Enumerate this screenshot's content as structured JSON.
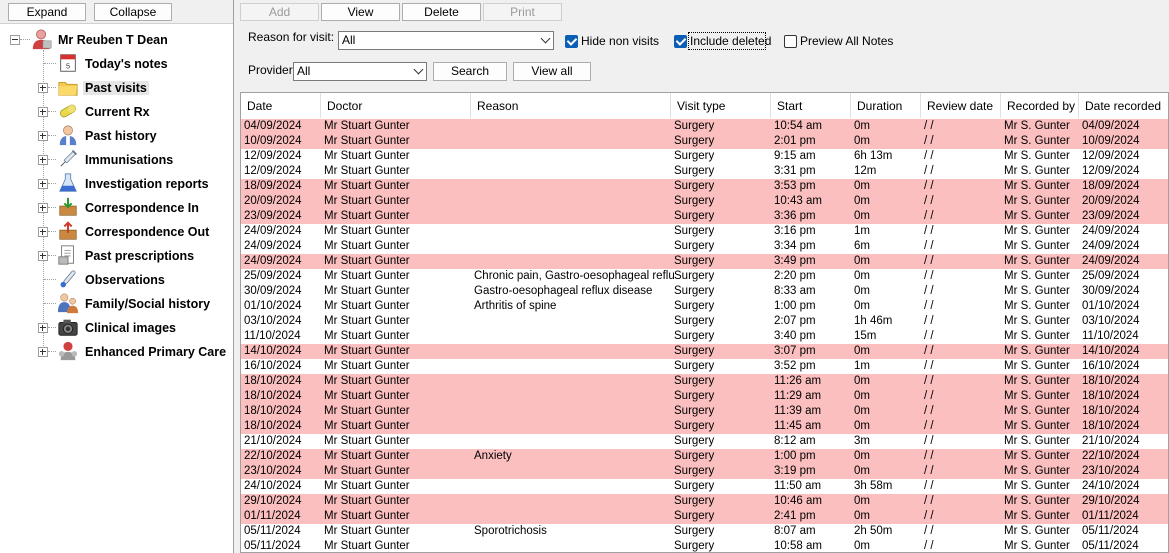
{
  "left_pane": {
    "expand_label": "Expand",
    "collapse_label": "Collapse",
    "root": {
      "label": "Mr Reuben T Dean",
      "icon": "person-icon"
    },
    "items": [
      {
        "label": "Today's notes",
        "icon": "calendar-icon",
        "expandable": false
      },
      {
        "label": "Past visits",
        "icon": "folder-icon",
        "expandable": true,
        "selected": true
      },
      {
        "label": "Current Rx",
        "icon": "pill-icon",
        "expandable": true
      },
      {
        "label": "Past history",
        "icon": "doctor-icon",
        "expandable": true
      },
      {
        "label": "Immunisations",
        "icon": "syringe-icon",
        "expandable": true
      },
      {
        "label": "Investigation reports",
        "icon": "flask-icon",
        "expandable": true
      },
      {
        "label": "Correspondence In",
        "icon": "inbox-icon",
        "expandable": true
      },
      {
        "label": "Correspondence Out",
        "icon": "outbox-icon",
        "expandable": true
      },
      {
        "label": "Past prescriptions",
        "icon": "prescription-icon",
        "expandable": true
      },
      {
        "label": "Observations",
        "icon": "thermometer-icon",
        "expandable": false
      },
      {
        "label": "Family/Social history",
        "icon": "family-icon",
        "expandable": false
      },
      {
        "label": "Clinical images",
        "icon": "camera-icon",
        "expandable": true
      },
      {
        "label": "Enhanced Primary Care",
        "icon": "team-icon",
        "expandable": true
      }
    ]
  },
  "toolbar": {
    "add_label": "Add",
    "view_label": "View",
    "delete_label": "Delete",
    "print_label": "Print"
  },
  "filters": {
    "reason_label": "Reason for visit:",
    "reason_value": "All",
    "hide_non_visits_label": "Hide non visits",
    "hide_non_visits_checked": true,
    "include_deleted_label": "Include deleted",
    "include_deleted_checked": true,
    "preview_all_notes_label": "Preview All Notes",
    "preview_all_notes_checked": false,
    "provider_label": "Provider:",
    "provider_value": "All",
    "search_label": "Search",
    "view_all_label": "View all"
  },
  "colors": {
    "highlight_row": "#fbbfbf",
    "checkbox_checked": "#0a5fb4"
  },
  "table": {
    "columns": [
      "Date",
      "Doctor",
      "Reason",
      "Visit type",
      "Start",
      "Duration",
      "Review date",
      "Recorded by",
      "Date recorded"
    ],
    "rows": [
      {
        "hl": true,
        "cells": [
          "04/09/2024",
          "Mr Stuart Gunter",
          "",
          "Surgery",
          "10:54 am",
          "0m",
          "/ /",
          "Mr S. Gunter",
          "04/09/2024"
        ]
      },
      {
        "hl": true,
        "cells": [
          "10/09/2024",
          "Mr Stuart Gunter",
          "",
          "Surgery",
          "2:01 pm",
          "0m",
          "/ /",
          "Mr S. Gunter",
          "10/09/2024"
        ]
      },
      {
        "hl": false,
        "cells": [
          "12/09/2024",
          "Mr Stuart Gunter",
          "",
          "Surgery",
          "9:15 am",
          "6h 13m",
          "/ /",
          "Mr S. Gunter",
          "12/09/2024"
        ]
      },
      {
        "hl": false,
        "cells": [
          "12/09/2024",
          "Mr Stuart Gunter",
          "",
          "Surgery",
          "3:31 pm",
          "12m",
          "/ /",
          "Mr S. Gunter",
          "12/09/2024"
        ]
      },
      {
        "hl": true,
        "cells": [
          "18/09/2024",
          "Mr Stuart Gunter",
          "",
          "Surgery",
          "3:53 pm",
          "0m",
          "/ /",
          "Mr S. Gunter",
          "18/09/2024"
        ]
      },
      {
        "hl": true,
        "cells": [
          "20/09/2024",
          "Mr Stuart Gunter",
          "",
          "Surgery",
          "10:43 am",
          "0m",
          "/ /",
          "Mr S. Gunter",
          "20/09/2024"
        ]
      },
      {
        "hl": true,
        "cells": [
          "23/09/2024",
          "Mr Stuart Gunter",
          "",
          "Surgery",
          "3:36 pm",
          "0m",
          "/ /",
          "Mr S. Gunter",
          "23/09/2024"
        ]
      },
      {
        "hl": false,
        "cells": [
          "24/09/2024",
          "Mr Stuart Gunter",
          "",
          "Surgery",
          "3:16 pm",
          "1m",
          "/ /",
          "Mr S. Gunter",
          "24/09/2024"
        ]
      },
      {
        "hl": false,
        "cells": [
          "24/09/2024",
          "Mr Stuart Gunter",
          "",
          "Surgery",
          "3:34 pm",
          "6m",
          "/ /",
          "Mr S. Gunter",
          "24/09/2024"
        ]
      },
      {
        "hl": true,
        "cells": [
          "24/09/2024",
          "Mr Stuart Gunter",
          "",
          "Surgery",
          "3:49 pm",
          "0m",
          "/ /",
          "Mr S. Gunter",
          "24/09/2024"
        ]
      },
      {
        "hl": false,
        "cells": [
          "25/09/2024",
          "Mr Stuart Gunter",
          "Chronic pain, Gastro-oesophageal reflux di",
          "Surgery",
          "2:20 pm",
          "0m",
          "/ /",
          "Mr S. Gunter",
          "25/09/2024"
        ]
      },
      {
        "hl": false,
        "cells": [
          "30/09/2024",
          "Mr Stuart Gunter",
          "Gastro-oesophageal reflux disease",
          "Surgery",
          "8:33 am",
          "0m",
          "/ /",
          "Mr S. Gunter",
          "30/09/2024"
        ]
      },
      {
        "hl": false,
        "cells": [
          "01/10/2024",
          "Mr Stuart Gunter",
          "Arthritis of spine",
          "Surgery",
          "1:00 pm",
          "0m",
          "/ /",
          "Mr S. Gunter",
          "01/10/2024"
        ]
      },
      {
        "hl": false,
        "cells": [
          "03/10/2024",
          "Mr Stuart Gunter",
          "",
          "Surgery",
          "2:07 pm",
          "1h 46m",
          "/ /",
          "Mr S. Gunter",
          "03/10/2024"
        ]
      },
      {
        "hl": false,
        "cells": [
          "11/10/2024",
          "Mr Stuart Gunter",
          "",
          "Surgery",
          "3:40 pm",
          "15m",
          "/ /",
          "Mr S. Gunter",
          "11/10/2024"
        ]
      },
      {
        "hl": true,
        "cells": [
          "14/10/2024",
          "Mr Stuart Gunter",
          "",
          "Surgery",
          "3:07 pm",
          "0m",
          "/ /",
          "Mr S. Gunter",
          "14/10/2024"
        ]
      },
      {
        "hl": false,
        "cells": [
          "16/10/2024",
          "Mr Stuart Gunter",
          "",
          "Surgery",
          "3:52 pm",
          "1m",
          "/ /",
          "Mr S. Gunter",
          "16/10/2024"
        ]
      },
      {
        "hl": true,
        "cells": [
          "18/10/2024",
          "Mr Stuart Gunter",
          "",
          "Surgery",
          "11:26 am",
          "0m",
          "/ /",
          "Mr S. Gunter",
          "18/10/2024"
        ]
      },
      {
        "hl": true,
        "cells": [
          "18/10/2024",
          "Mr Stuart Gunter",
          "",
          "Surgery",
          "11:29 am",
          "0m",
          "/ /",
          "Mr S. Gunter",
          "18/10/2024"
        ]
      },
      {
        "hl": true,
        "cells": [
          "18/10/2024",
          "Mr Stuart Gunter",
          "",
          "Surgery",
          "11:39 am",
          "0m",
          "/ /",
          "Mr S. Gunter",
          "18/10/2024"
        ]
      },
      {
        "hl": true,
        "cells": [
          "18/10/2024",
          "Mr Stuart Gunter",
          "",
          "Surgery",
          "11:45 am",
          "0m",
          "/ /",
          "Mr S. Gunter",
          "18/10/2024"
        ]
      },
      {
        "hl": false,
        "cells": [
          "21/10/2024",
          "Mr Stuart Gunter",
          "",
          "Surgery",
          "8:12 am",
          "3m",
          "/ /",
          "Mr S. Gunter",
          "21/10/2024"
        ]
      },
      {
        "hl": true,
        "cells": [
          "22/10/2024",
          "Mr Stuart Gunter",
          "Anxiety",
          "Surgery",
          "1:00 pm",
          "0m",
          "/ /",
          "Mr S. Gunter",
          "22/10/2024"
        ]
      },
      {
        "hl": true,
        "cells": [
          "23/10/2024",
          "Mr Stuart Gunter",
          "",
          "Surgery",
          "3:19 pm",
          "0m",
          "/ /",
          "Mr S. Gunter",
          "23/10/2024"
        ]
      },
      {
        "hl": false,
        "cells": [
          "24/10/2024",
          "Mr Stuart Gunter",
          "",
          "Surgery",
          "11:50 am",
          "3h 58m",
          "/ /",
          "Mr S. Gunter",
          "24/10/2024"
        ]
      },
      {
        "hl": true,
        "cells": [
          "29/10/2024",
          "Mr Stuart Gunter",
          "",
          "Surgery",
          "10:46 am",
          "0m",
          "/ /",
          "Mr S. Gunter",
          "29/10/2024"
        ]
      },
      {
        "hl": true,
        "cells": [
          "01/11/2024",
          "Mr Stuart Gunter",
          "",
          "Surgery",
          "2:41 pm",
          "0m",
          "/ /",
          "Mr S. Gunter",
          "01/11/2024"
        ]
      },
      {
        "hl": false,
        "cells": [
          "05/11/2024",
          "Mr Stuart Gunter",
          "Sporotrichosis",
          "Surgery",
          "8:07 am",
          "2h 50m",
          "/ /",
          "Mr S. Gunter",
          "05/11/2024"
        ]
      },
      {
        "hl": false,
        "cells": [
          "05/11/2024",
          "Mr Stuart Gunter",
          "",
          "Surgery",
          "10:58 am",
          "0m",
          "/ /",
          "Mr S. Gunter",
          "05/11/2024"
        ]
      }
    ]
  }
}
